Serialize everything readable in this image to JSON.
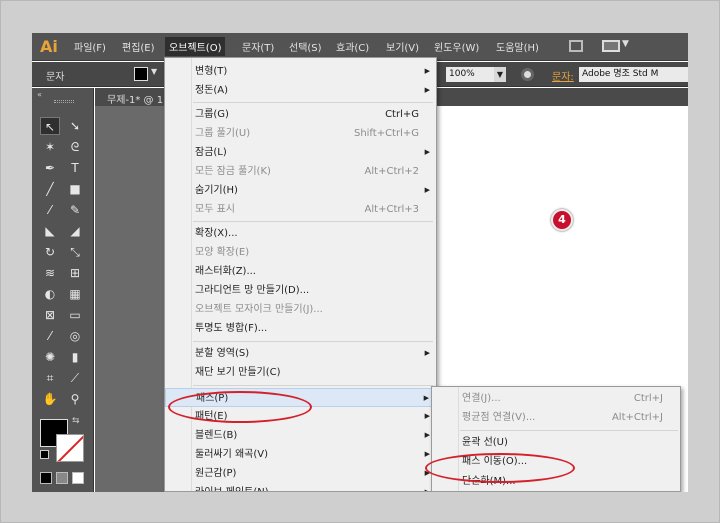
{
  "app": {
    "logo": "Ai"
  },
  "menubar": {
    "items": [
      {
        "label": "파일(F)"
      },
      {
        "label": "편집(E)"
      },
      {
        "label": "오브젝트(O)",
        "active": true
      },
      {
        "label": "문자(T)"
      },
      {
        "label": "선택(S)"
      },
      {
        "label": "효과(C)"
      },
      {
        "label": "보기(V)"
      },
      {
        "label": "윈도우(W)"
      },
      {
        "label": "도움말(H)"
      }
    ]
  },
  "controlbar": {
    "label": "문자",
    "zoom": "100%",
    "char_label": "문자:",
    "font": "Adobe 명조 Std M"
  },
  "document": {
    "tab": "무제-1* @ 1"
  },
  "object_menu": {
    "items": [
      {
        "label": "변형(T)",
        "submenu": true
      },
      {
        "label": "정돈(A)",
        "submenu": true
      },
      {
        "label": "그룹(G)",
        "shortcut": "Ctrl+G"
      },
      {
        "label": "그룹 풀기(U)",
        "shortcut": "Shift+Ctrl+G",
        "disabled": true
      },
      {
        "label": "잠금(L)",
        "submenu": true
      },
      {
        "label": "모든 잠금 풀기(K)",
        "shortcut": "Alt+Ctrl+2",
        "disabled": true
      },
      {
        "label": "숨기기(H)",
        "submenu": true
      },
      {
        "label": "모두 표시",
        "shortcut": "Alt+Ctrl+3",
        "disabled": true
      },
      {
        "label": "확장(X)..."
      },
      {
        "label": "모양 확장(E)",
        "disabled": true
      },
      {
        "label": "래스터화(Z)..."
      },
      {
        "label": "그라디언트 망 만들기(D)..."
      },
      {
        "label": "오브젝트 모자이크 만들기(J)...",
        "disabled": true
      },
      {
        "label": "투명도 병합(F)..."
      },
      {
        "label": "분할 영역(S)",
        "submenu": true
      },
      {
        "label": "재단 보기 만들기(C)"
      },
      {
        "label": "패스(P)",
        "submenu": true,
        "highlighted": true
      },
      {
        "label": "패턴(E)",
        "submenu": true
      },
      {
        "label": "블렌드(B)",
        "submenu": true
      },
      {
        "label": "둘러싸기 왜곡(V)",
        "submenu": true
      },
      {
        "label": "원근감(P)",
        "submenu": true
      },
      {
        "label": "라이브 페인트(N)",
        "submenu": true
      }
    ]
  },
  "path_submenu": {
    "items": [
      {
        "label": "연결(J)...",
        "shortcut": "Ctrl+J",
        "disabled": true
      },
      {
        "label": "평균점 연결(V)...",
        "shortcut": "Alt+Ctrl+J",
        "disabled": true
      },
      {
        "label": "윤곽 선(U)"
      },
      {
        "label": "패스 이동(O)..."
      },
      {
        "label": "단순화(M)..."
      }
    ]
  },
  "annotation": {
    "step": "4"
  },
  "colors": {
    "accent": "#e8a33a",
    "ring": "#d4202a",
    "badge": "#c8102e",
    "highlight": "#dde8f6"
  }
}
